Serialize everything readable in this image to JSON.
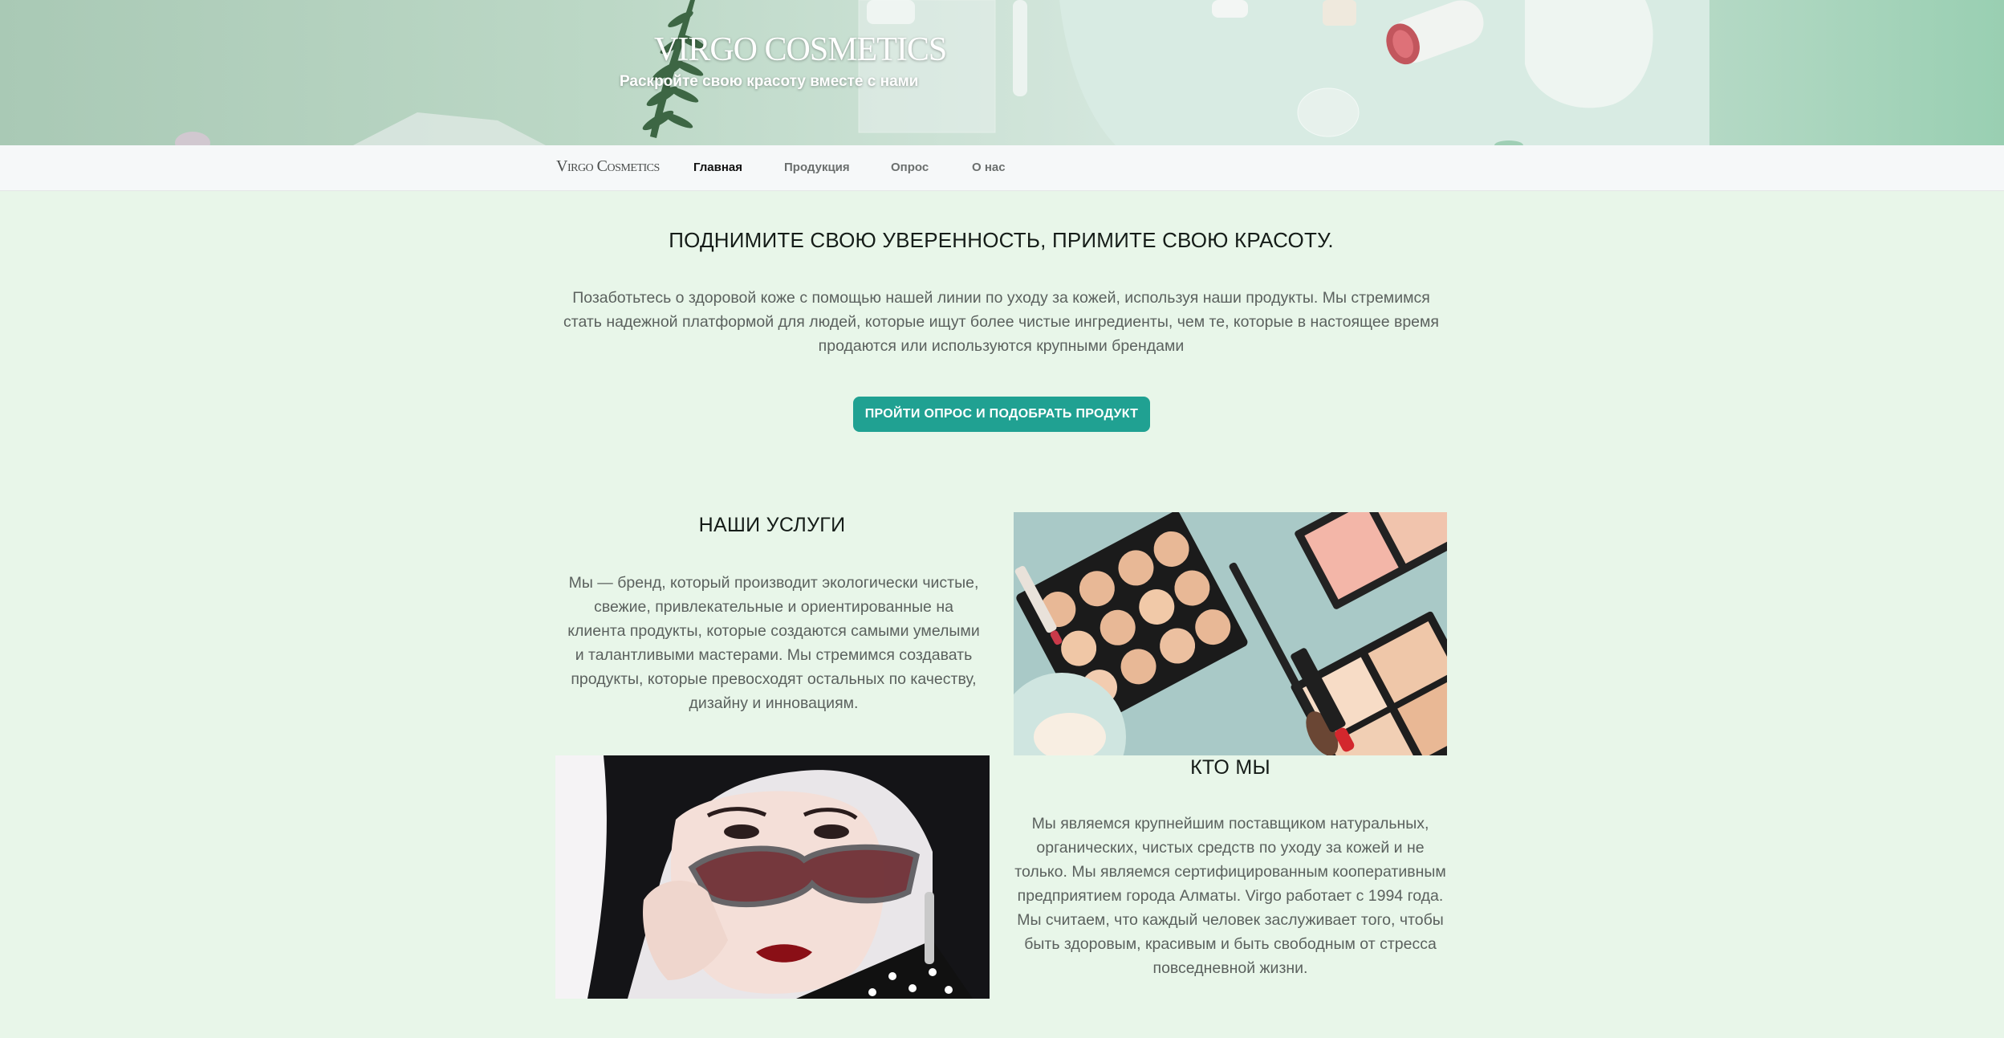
{
  "hero": {
    "title": "VIRGO COSMETICS",
    "subtitle": "Раскройте свою красоту вместе с нами"
  },
  "navbar": {
    "brand": "Virgo Cosmetics",
    "links": [
      "Главная",
      "Продукция",
      "Опрос",
      "О нас"
    ],
    "active": "Главная"
  },
  "intro": {
    "heading": "ПОДНИМИТЕ СВОЮ УВЕРЕННОСТЬ, ПРИМИТЕ СВОЮ КРАСОТУ.",
    "text": "Позаботьтесь о здоровой коже с помощью нашей линии по уходу за кожей, используя наши продукты. Мы стремимся стать надежной платформой для людей, которые ищут более чистые ингредиенты, чем те, которые в настоящее время продаются или используются крупными брендами",
    "cta_label": "ПРОЙТИ ОПРОС И ПОДОБРАТЬ ПРОДУКТ"
  },
  "services": {
    "heading": "НАШИ УСЛУГИ",
    "text": "Мы — бренд, который производит экологически чистые, свежие, привлекательные и ориентированные на клиента продукты, которые создаются самыми умелыми и талантливыми мастерами. Мы стремимся создавать продукты, которые превосходят остальных по качеству, дизайну и инновациям."
  },
  "about": {
    "heading": "КТО МЫ",
    "text": "Мы являемся крупнейшим поставщиком натуральных, органических, чистых средств по уходу за кожей и не только. Мы являемся сертифицированным кооперативным предприятием города Алматы. Virgo работает с 1994 года. Мы считаем, что каждый человек заслуживает того, чтобы быть здоровым, красивым и быть свободным от стресса повседневной жизни."
  },
  "colors": {
    "page_bg": "#e8f6e9",
    "accent": "#20a192",
    "navbar_bg": "#f6f8f9"
  }
}
